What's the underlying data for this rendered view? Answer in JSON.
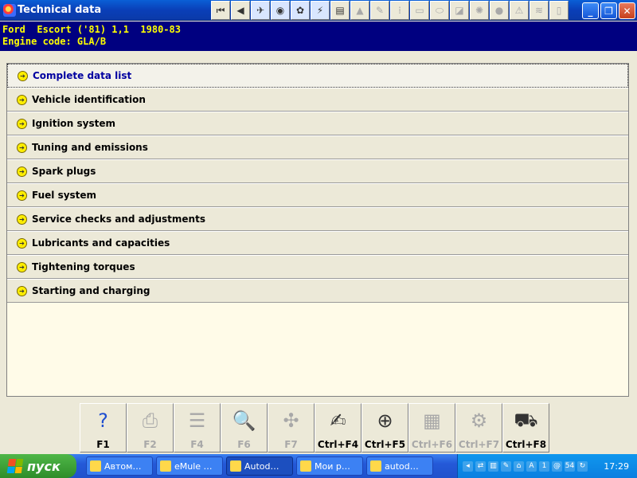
{
  "window": {
    "title": "Technical data",
    "controls": {
      "minimize": "_",
      "maximize": "❐",
      "close": "✕"
    }
  },
  "toolbar": {
    "buttons": [
      {
        "icon": "first-page-icon",
        "glyph": "⏮"
      },
      {
        "icon": "back-icon",
        "glyph": "◀"
      },
      {
        "icon": "car-lift-icon",
        "glyph": "✈"
      },
      {
        "icon": "wheel-icon",
        "glyph": "◉"
      },
      {
        "icon": "parts-icon",
        "glyph": "✿"
      },
      {
        "icon": "wiring-icon",
        "glyph": "⚡"
      },
      {
        "icon": "engine-icon",
        "glyph": "▤"
      },
      {
        "icon": "body-icon",
        "glyph": "▲"
      },
      {
        "icon": "tools-icon",
        "glyph": "✎"
      },
      {
        "icon": "timing-icon",
        "glyph": "⁞"
      },
      {
        "icon": "seat-icon",
        "glyph": "▭"
      },
      {
        "icon": "car-icon",
        "glyph": "⬭"
      },
      {
        "icon": "door-icon",
        "glyph": "◪"
      },
      {
        "icon": "suspension-icon",
        "glyph": "✺"
      },
      {
        "icon": "airbag-icon",
        "glyph": "●"
      },
      {
        "icon": "warning-icon",
        "glyph": "⚠"
      },
      {
        "icon": "chassis-icon",
        "glyph": "≋"
      },
      {
        "icon": "book-icon",
        "glyph": "▯"
      }
    ]
  },
  "vehicle": {
    "line1": "Ford  Escort ('81) 1,1  1980-83",
    "line2": "Engine code: GLA/B"
  },
  "menu": {
    "items": [
      {
        "label": "Complete data list"
      },
      {
        "label": "Vehicle identification"
      },
      {
        "label": "Ignition system"
      },
      {
        "label": "Tuning and emissions"
      },
      {
        "label": "Spark plugs"
      },
      {
        "label": "Fuel system"
      },
      {
        "label": "Service checks and adjustments"
      },
      {
        "label": "Lubricants and capacities"
      },
      {
        "label": "Tightening torques"
      },
      {
        "label": "Starting and charging"
      }
    ],
    "selected_index": 0
  },
  "fkeys": [
    {
      "key": "F1",
      "icon": "help-icon",
      "glyph": "?",
      "enabled": true
    },
    {
      "key": "F2",
      "icon": "print-icon",
      "glyph": "⎙",
      "enabled": false
    },
    {
      "key": "F4",
      "icon": "list-icon",
      "glyph": "☰",
      "enabled": false
    },
    {
      "key": "F6",
      "icon": "search-text-icon",
      "glyph": "🔍",
      "enabled": false
    },
    {
      "key": "F7",
      "icon": "diagram-icon",
      "glyph": "✣",
      "enabled": false
    },
    {
      "key": "Ctrl+F4",
      "icon": "notes-icon",
      "glyph": "✍",
      "enabled": true
    },
    {
      "key": "Ctrl+F5",
      "icon": "add-note-icon",
      "glyph": "⊕",
      "enabled": true
    },
    {
      "key": "Ctrl+F6",
      "icon": "calculator-icon",
      "glyph": "▦",
      "enabled": false
    },
    {
      "key": "Ctrl+F7",
      "icon": "settings-icon",
      "glyph": "⚙",
      "enabled": false
    },
    {
      "key": "Ctrl+F8",
      "icon": "lift-icon",
      "glyph": "⛟",
      "enabled": true
    }
  ],
  "taskbar": {
    "start_label": "пуск",
    "tasks": [
      {
        "label": "Автом…",
        "active": false
      },
      {
        "label": "eMule …",
        "active": false
      },
      {
        "label": "Autod…",
        "active": true
      },
      {
        "label": "Мои р…",
        "active": false
      },
      {
        "label": "autod…",
        "active": false
      }
    ],
    "tray": {
      "icons": [
        "◂",
        "⇄",
        "▥",
        "✎",
        "⌂",
        "A",
        "1",
        "@",
        "54",
        "↻"
      ],
      "clock": "17:29"
    }
  }
}
